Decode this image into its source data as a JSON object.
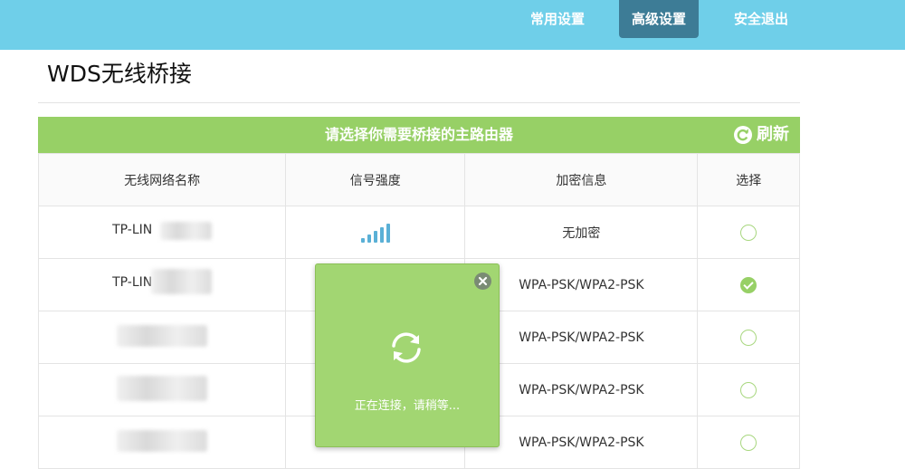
{
  "nav": {
    "items": [
      {
        "label": "常用设置",
        "active": false
      },
      {
        "label": "高级设置",
        "active": true
      },
      {
        "label": "安全退出",
        "active": false
      }
    ]
  },
  "page": {
    "title": "WDS无线桥接"
  },
  "banner": {
    "text": "请选择你需要桥接的主路由器",
    "refresh_label": "刷新"
  },
  "table": {
    "headers": [
      "无线网络名称",
      "信号强度",
      "加密信息",
      "选择"
    ],
    "rows": [
      {
        "ssid": "TP-LIN",
        "signal": "full",
        "encryption": "无加密",
        "selected": false
      },
      {
        "ssid": "TP-LIN",
        "signal": "hidden",
        "encryption": "WPA-PSK/WPA2-PSK",
        "selected": true
      },
      {
        "ssid": "",
        "signal": "hidden",
        "encryption": "WPA-PSK/WPA2-PSK",
        "selected": false
      },
      {
        "ssid": "",
        "signal": "hidden",
        "encryption": "WPA-PSK/WPA2-PSK",
        "selected": false
      },
      {
        "ssid": "",
        "signal": "hidden",
        "encryption": "WPA-PSK/WPA2-PSK",
        "selected": false
      }
    ]
  },
  "popup": {
    "message": "正在连接，请稍等..."
  },
  "colors": {
    "nav_bg": "#6fcfe9",
    "nav_active": "#3d7c96",
    "accent_green": "#97d066",
    "signal_blue": "#5ab0d6"
  }
}
